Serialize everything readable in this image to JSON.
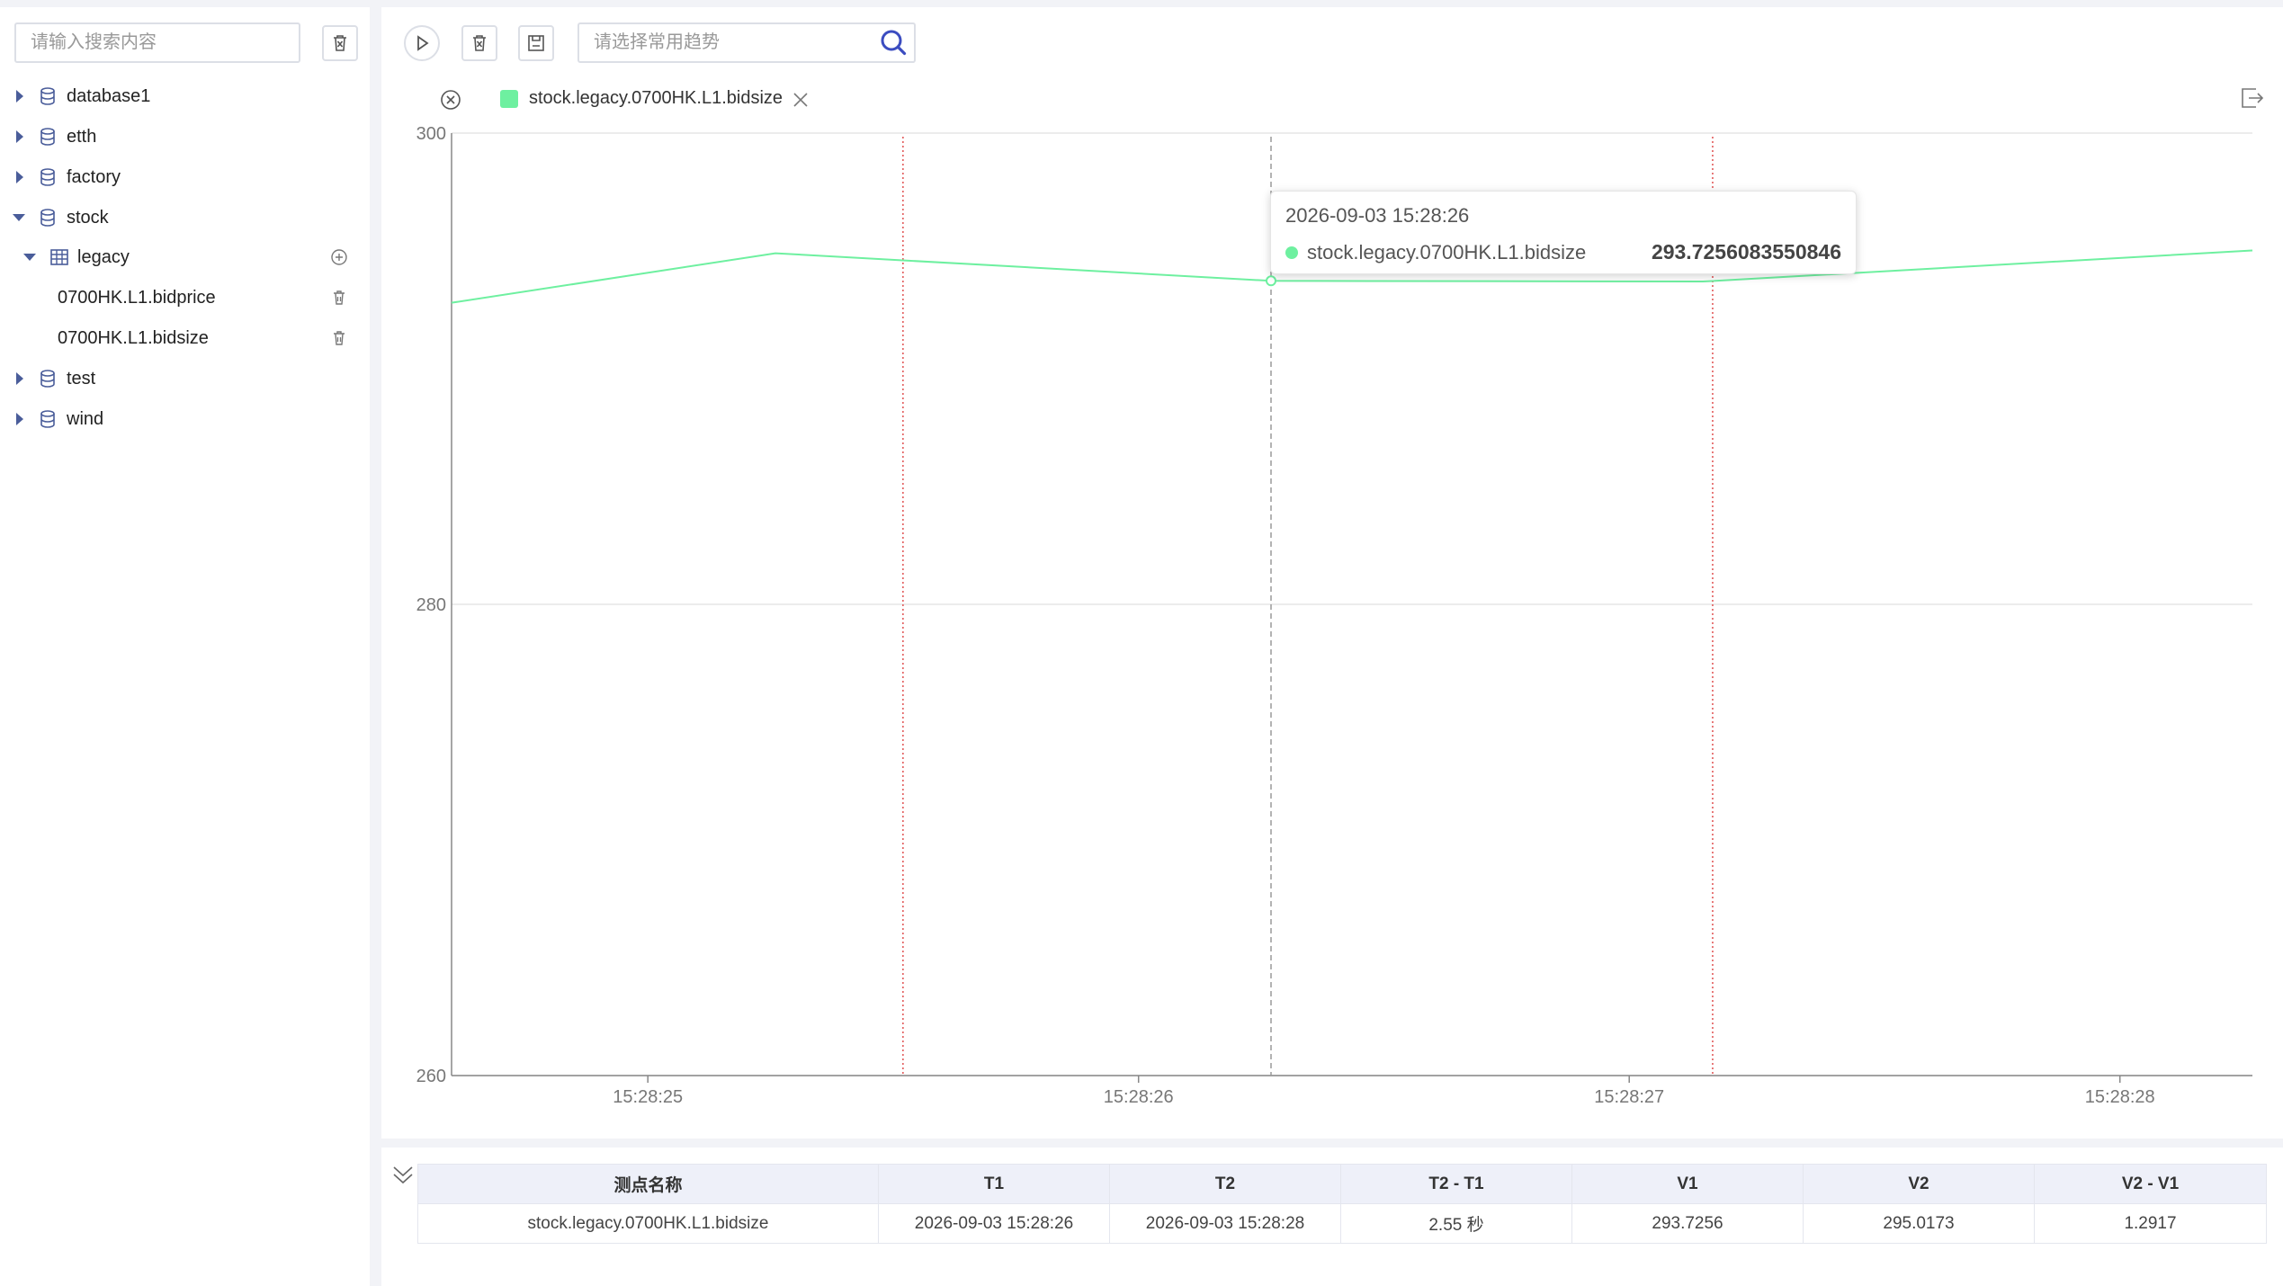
{
  "sidebar": {
    "search_placeholder": "请输入搜索内容",
    "tree": [
      {
        "label": "database1",
        "expanded": false
      },
      {
        "label": "etth",
        "expanded": false
      },
      {
        "label": "factory",
        "expanded": false
      },
      {
        "label": "stock",
        "expanded": true
      },
      {
        "label": "legacy",
        "expanded": true
      },
      {
        "label": "0700HK.L1.bidprice"
      },
      {
        "label": "0700HK.L1.bidsize"
      },
      {
        "label": "test",
        "expanded": false
      },
      {
        "label": "wind",
        "expanded": false
      }
    ]
  },
  "toolbar": {
    "trend_placeholder": "请选择常用趋势"
  },
  "legend": {
    "series_name": "stock.legacy.0700HK.L1.bidsize",
    "color": "#6ef0a0"
  },
  "tooltip": {
    "time": "2026-09-03 15:28:26",
    "series": "stock.legacy.0700HK.L1.bidsize",
    "value": "293.7256083550846"
  },
  "chart_data": {
    "type": "line",
    "series": [
      {
        "name": "stock.legacy.0700HK.L1.bidsize",
        "color": "#6ef0a0",
        "points": [
          {
            "t": 24.6,
            "y": 292.8
          },
          {
            "t": 25.26,
            "y": 294.9
          },
          {
            "t": 26.27,
            "y": 293.73
          },
          {
            "t": 27.15,
            "y": 293.7
          },
          {
            "t": 28.27,
            "y": 295.02
          }
        ]
      }
    ],
    "x_ticks": [
      "15:28:25",
      "15:28:26",
      "15:28:27",
      "15:28:28"
    ],
    "x_tick_values": [
      25,
      26,
      27,
      28
    ],
    "xlim": [
      24.6,
      28.27
    ],
    "y_ticks": [
      260,
      280,
      300
    ],
    "ylim": [
      260,
      300
    ],
    "cursors": [
      {
        "t": 25.52,
        "style": "red-dotted"
      },
      {
        "t": 26.27,
        "style": "gray-dashed"
      },
      {
        "t": 27.17,
        "style": "red-dotted"
      }
    ]
  },
  "table": {
    "headers": [
      "测点名称",
      "T1",
      "T2",
      "T2 - T1",
      "V1",
      "V2",
      "V2 - V1"
    ],
    "rows": [
      [
        "stock.legacy.0700HK.L1.bidsize",
        "2026-09-03 15:28:26",
        "2026-09-03 15:28:28",
        "2.55 秒",
        "293.7256",
        "295.0173",
        "1.2917"
      ]
    ]
  }
}
